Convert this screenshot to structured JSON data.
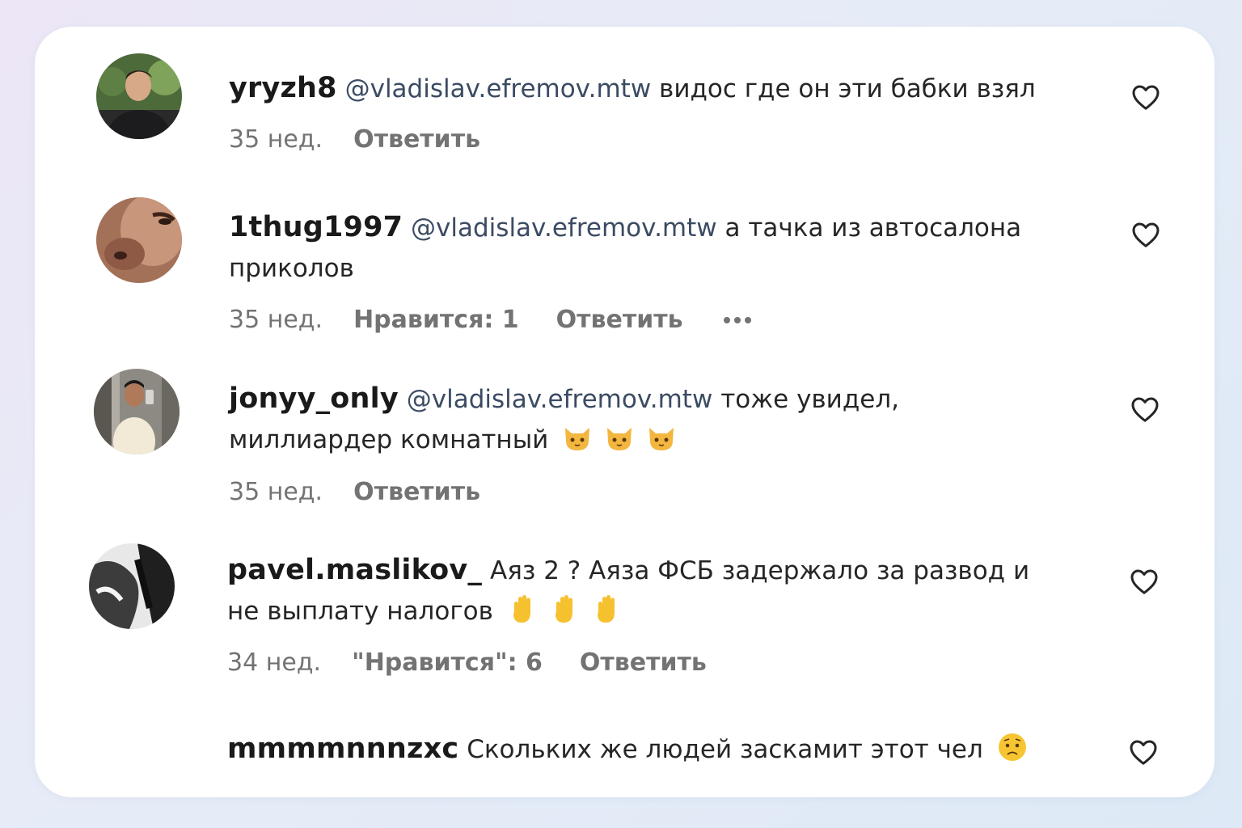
{
  "comments": [
    {
      "username": "yryzh8",
      "mention": "@vladislav.efremov.mtw",
      "text": "видос где он эти бабки взял",
      "time": "35 нед.",
      "reply_label": "Ответить"
    },
    {
      "username": "1thug1997",
      "mention": "@vladislav.efremov.mtw",
      "text": "а тачка из автосалона приколов",
      "time": "35 нед.",
      "likes": "Нравится: 1",
      "reply_label": "Ответить"
    },
    {
      "username": "jonyy_only",
      "mention": "@vladislav.efremov.mtw",
      "text": "тоже увидел, миллиардер комнатный",
      "emoji": [
        "cat-face-icon",
        "cat-face-icon",
        "cat-face-icon"
      ],
      "time": "35 нед.",
      "reply_label": "Ответить"
    },
    {
      "username": "pavel.maslikov_",
      "text": "Аяз 2 ? Аяза ФСБ задержало за развод и не выплату налогов",
      "emoji": [
        "raised-hand-icon",
        "raised-hand-icon",
        "raised-hand-icon"
      ],
      "time": "34 нед.",
      "likes": "\"Нравится\": 6",
      "reply_label": "Ответить"
    },
    {
      "username": "mmmmnnnzxc",
      "text": "Скольких же людей заскамит этот чел",
      "emoji": [
        "worried-face-icon"
      ]
    }
  ],
  "colors": {
    "username": "#1a1a1a",
    "mention": "#3b4b63",
    "meta": "#737373",
    "card": "#ffffff"
  }
}
